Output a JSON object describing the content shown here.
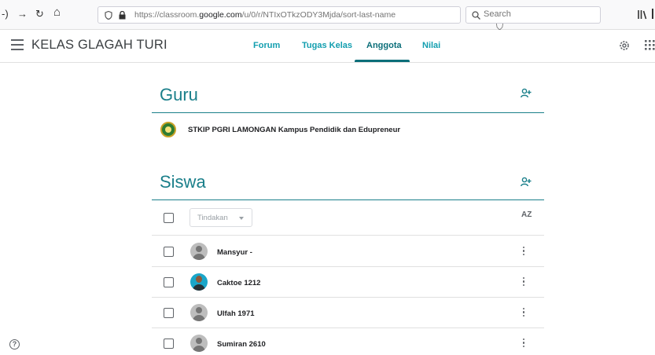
{
  "browser": {
    "back": "⟩",
    "forward": "→",
    "reload": "↻",
    "home": "⌂",
    "url_prefix": "https://classroom.",
    "url_domain": "google.com",
    "url_path": "/u/0/r/NTIxOTkzODY3Mjda/sort-last-name",
    "search_placeholder": "Search",
    "url_icons": "··· ⛉ ☆"
  },
  "header": {
    "class_title": "KELAS GLAGAH TURI",
    "tabs": [
      {
        "label": "Forum",
        "active": false
      },
      {
        "label": "Tugas Kelas",
        "active": false
      },
      {
        "label": "Anggota",
        "active": true
      },
      {
        "label": "Nilai",
        "active": false
      }
    ]
  },
  "teachers": {
    "title": "Guru",
    "items": [
      {
        "name": "STKIP PGRI LAMONGAN Kampus Pendidik dan Edupreneur"
      }
    ]
  },
  "students": {
    "title": "Siswa",
    "actions_label": "Tindakan",
    "sort_label": "AZ",
    "items": [
      {
        "name": "Mansyur -",
        "avatar": "default"
      },
      {
        "name": "Caktoe 1212",
        "avatar": "photo"
      },
      {
        "name": "Ulfah 1971",
        "avatar": "default"
      },
      {
        "name": "Sumiran 2610",
        "avatar": "default"
      }
    ]
  },
  "colors": {
    "accent": "#1a7f8a",
    "tab_active": "#0b6e79"
  },
  "help": "?"
}
